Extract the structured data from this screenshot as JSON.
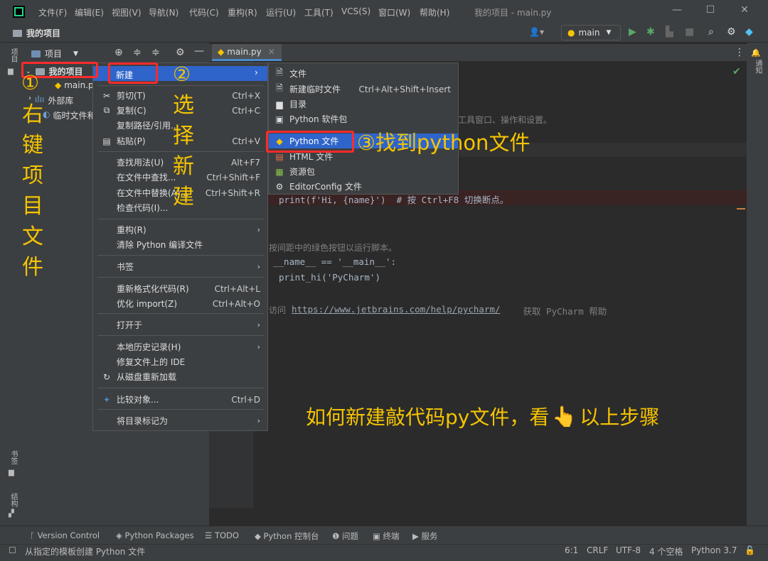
{
  "titlebar": {
    "menu": [
      "文件(F)",
      "编辑(E)",
      "视图(V)",
      "导航(N)",
      "代码(C)",
      "重构(R)",
      "运行(U)",
      "工具(T)",
      "VCS(S)",
      "窗口(W)",
      "帮助(H)"
    ],
    "window_title": "我的项目 - main.py"
  },
  "navbar": {
    "project": "我的项目",
    "branch": "main"
  },
  "left_stripe": {
    "project_tab": "项目",
    "bookmarks_tab": "书签",
    "structure_tab": "结构"
  },
  "right_stripe": {
    "notifications_tab": "通知"
  },
  "project_panel": {
    "header": "项目",
    "tree": {
      "root": "我的项目",
      "file": "main.py",
      "ext_lib": "外部库",
      "scratch": "临时文件和控制台"
    }
  },
  "editor": {
    "tab": "main.py",
    "lines": {
      "hint1": "工具窗口、操作和设置。",
      "print_call": "print(f'Hi, {name}')  # 按 Ctrl+F8 切换断点。",
      "hint2": "按间距中的绿色按钮以运行脚本。",
      "main_guard": "__name__ == '__main__':",
      "print_hi": "print_hi('PyCharm')",
      "help_prefix": "访问 ",
      "help_url": "https://www.jetbrains.com/help/pycharm/",
      "help_suffix": " 获取 PyCharm 帮助"
    }
  },
  "context_menu": {
    "new": "新建",
    "cut": {
      "label": "剪切(T)",
      "shortcut": "Ctrl+X"
    },
    "copy": {
      "label": "复制(C)",
      "shortcut": "Ctrl+C"
    },
    "copy_path": "复制路径/引用...",
    "paste": {
      "label": "粘贴(P)",
      "shortcut": "Ctrl+V"
    },
    "find_usages": {
      "label": "查找用法(U)",
      "shortcut": "Alt+F7"
    },
    "find_in_files": {
      "label": "在文件中查找...",
      "shortcut": "Ctrl+Shift+F"
    },
    "replace_in_files": {
      "label": "在文件中替换(A)...",
      "shortcut": "Ctrl+Shift+R"
    },
    "inspect_code": "检查代码(I)...",
    "refactor": "重构(R)",
    "clean_python": "清除 Python 编译文件",
    "bookmarks": "书签",
    "reformat": {
      "label": "重新格式化代码(R)",
      "shortcut": "Ctrl+Alt+L"
    },
    "optimize_imports": {
      "label": "优化 import(Z)",
      "shortcut": "Ctrl+Alt+O"
    },
    "open_in": "打开于",
    "local_history": "本地历史记录(H)",
    "repair_ide": "修复文件上的 IDE",
    "reload_from_disk": "从磁盘重新加载",
    "compare_with": {
      "label": "比较对象...",
      "shortcut": "Ctrl+D"
    },
    "mark_directory": "将目录标记为"
  },
  "submenu": {
    "file": "文件",
    "scratch": {
      "label": "新建临时文件",
      "shortcut": "Ctrl+Alt+Shift+Insert"
    },
    "directory": "目录",
    "python_package": "Python 软件包",
    "python_file": "Python 文件",
    "html_file": "HTML 文件",
    "resource_bundle": "资源包",
    "editorconfig": "EditorConfig 文件"
  },
  "annotations": {
    "step1_num": "①",
    "step1_text": [
      "右",
      "键",
      "项",
      "目",
      "文",
      "件"
    ],
    "step2_num": "②",
    "step2_text": [
      "选",
      "择",
      "新",
      "建"
    ],
    "step3": "③找到python文件",
    "summary_pre": "如何新建敲代码py文件，看",
    "summary_post": "以上步骤"
  },
  "bottom_toolbar": [
    "Version Control",
    "Python Packages",
    "TODO",
    "Python 控制台",
    "问题",
    "终端",
    "服务"
  ],
  "statusbar": {
    "message": "从指定的模板创建 Python 文件",
    "position": "6:1",
    "line_sep": "CRLF",
    "encoding": "UTF-8",
    "indent": "4 个空格",
    "interpreter": "Python 3.7"
  },
  "colors": {
    "accent": "#2f65ca",
    "annotation": "#f5c400",
    "highlight_box": "#ff2b2b"
  }
}
